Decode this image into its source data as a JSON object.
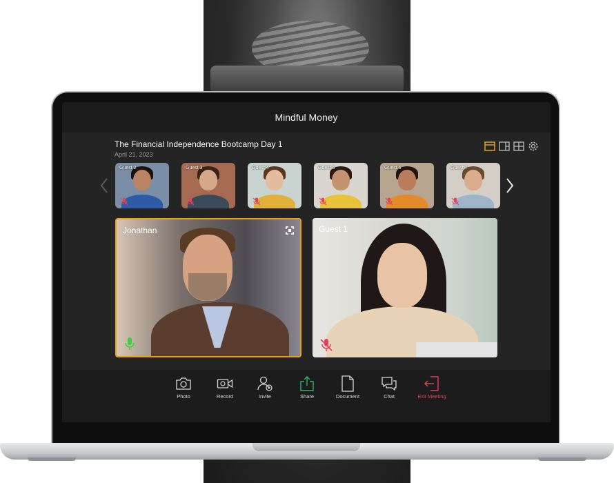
{
  "app": {
    "window_title": "Mindful Money"
  },
  "meeting": {
    "title": "The Financial Independence Bootcamp Day 1",
    "date": "April 21, 2023"
  },
  "layout_tools": [
    {
      "icon": "speaker-view-icon",
      "active": true
    },
    {
      "icon": "sidebar-view-icon",
      "active": false
    },
    {
      "icon": "grid-view-icon",
      "active": false
    },
    {
      "icon": "settings-gear-icon",
      "active": false
    }
  ],
  "guests": [
    {
      "label": "Guest 2",
      "muted": true,
      "shirt": "#2f5aa8",
      "skin": "#b98463",
      "hair": "#1b120c",
      "bg": "#7a8fa5"
    },
    {
      "label": "Guest 3",
      "muted": true,
      "shirt": "#3a4a5a",
      "skin": "#d6a98a",
      "hair": "#3a2414",
      "bg": "#a66a52"
    },
    {
      "label": "Guest 4",
      "muted": true,
      "shirt": "#e0b03a",
      "skin": "#e4bda0",
      "hair": "#5a361f",
      "bg": "#c9d3cf"
    },
    {
      "label": "Guest 5",
      "muted": true,
      "shirt": "#e8c23a",
      "skin": "#c4936f",
      "hair": "#2a1a12",
      "bg": "#d9d6cf"
    },
    {
      "label": "Guest 6",
      "muted": true,
      "shirt": "#e38a2a",
      "skin": "#b97f5c",
      "hair": "#201410",
      "bg": "#b7a58f"
    },
    {
      "label": "Guest 7",
      "muted": true,
      "shirt": "#9fb4c8",
      "skin": "#d9ad8e",
      "hair": "#6a4a2e",
      "bg": "#d4cfc6"
    }
  ],
  "tiles": [
    {
      "label": "Jonathan",
      "mic": "on",
      "active": true
    },
    {
      "label": "Guest 1",
      "mic": "muted",
      "active": false
    }
  ],
  "toolbar": {
    "photo": "Photo",
    "record": "Record",
    "invite": "Invite",
    "share": "Share",
    "document": "Document",
    "chat": "Chat",
    "exit": "Exit Meeting"
  },
  "colors": {
    "accent": "#e8a317",
    "mic_on": "#3ecf3e",
    "muted": "#e0445a",
    "share": "#2fb36a"
  }
}
